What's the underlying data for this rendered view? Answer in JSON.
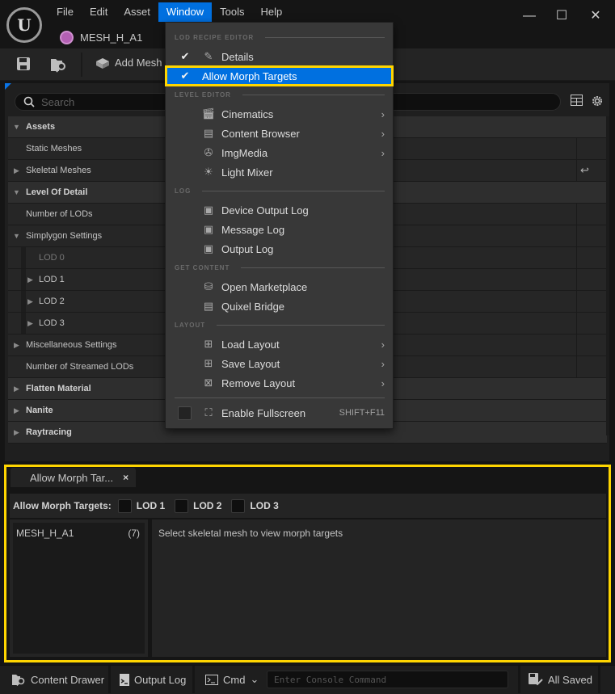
{
  "app": {
    "logo_glyph": "U",
    "menu": [
      "File",
      "Edit",
      "Asset",
      "Window",
      "Tools",
      "Help"
    ],
    "active_menu": "Window",
    "document_tab": "MESH_H_A1",
    "window_controls": {
      "minimize": "—",
      "maximize": "☐",
      "close": "✕"
    }
  },
  "toolbar": {
    "save_icon": "save-icon",
    "browse_icon": "browse-content-icon",
    "add_mesh_label": "Add Mesh"
  },
  "details": {
    "search_placeholder": "Search",
    "rows": [
      {
        "label": "Assets",
        "type": "category",
        "expanded": true
      },
      {
        "label": "Static Meshes",
        "type": "property"
      },
      {
        "label": "Skeletal Meshes",
        "type": "property",
        "collapsed": true,
        "reset": true
      },
      {
        "label": "Level Of Detail",
        "type": "category",
        "expanded": true
      },
      {
        "label": "Number of LODs",
        "type": "property"
      },
      {
        "label": "Simplygon Settings",
        "type": "group",
        "expanded": true
      },
      {
        "label": "LOD 0",
        "type": "sub",
        "disabled": true
      },
      {
        "label": "LOD 1",
        "type": "sub",
        "collapsed": true
      },
      {
        "label": "LOD 2",
        "type": "sub",
        "collapsed": true
      },
      {
        "label": "LOD 3",
        "type": "sub",
        "collapsed": true
      },
      {
        "label": "Miscellaneous  Settings",
        "type": "property",
        "collapsed": true
      },
      {
        "label": "Number of Streamed LODs",
        "type": "property"
      },
      {
        "label": "Flatten Material",
        "type": "category",
        "collapsed": true
      },
      {
        "label": "Nanite",
        "type": "category",
        "collapsed": true
      },
      {
        "label": "Raytracing",
        "type": "category",
        "collapsed": true
      }
    ]
  },
  "window_menu": {
    "sections": {
      "lod_recipe_editor": "LOD RECIPE EDITOR",
      "level_editor": "LEVEL EDITOR",
      "log": "LOG",
      "get_content": "GET CONTENT",
      "layout": "LAYOUT"
    },
    "items": {
      "details": "Details",
      "allow_morph_targets": "Allow Morph Targets",
      "cinematics": "Cinematics",
      "content_browser": "Content Browser",
      "imgmedia": "ImgMedia",
      "light_mixer": "Light Mixer",
      "device_output_log": "Device Output Log",
      "message_log": "Message Log",
      "output_log": "Output Log",
      "open_marketplace": "Open Marketplace",
      "quixel_bridge": "Quixel Bridge",
      "load_layout": "Load Layout",
      "save_layout": "Save Layout",
      "remove_layout": "Remove Layout",
      "enable_fullscreen": "Enable Fullscreen"
    },
    "shortcut_fullscreen": "SHIFT+F11",
    "checked": [
      "Details",
      "Allow Morph Targets"
    ]
  },
  "morph_panel": {
    "tab_label": "Allow Morph Tar...",
    "tab_close": "×",
    "bar_title": "Allow Morph Targets:",
    "lods": [
      "LOD 1",
      "LOD 2",
      "LOD 3"
    ],
    "mesh_name": "MESH_H_A1",
    "mesh_count": "(7)",
    "message": "Select skeletal mesh to view morph targets"
  },
  "statusbar": {
    "content_drawer": "Content Drawer",
    "output_log": "Output Log",
    "cmd": "Cmd",
    "console_placeholder": "Enter Console Command",
    "saved": "All Saved"
  },
  "colors": {
    "accent": "#0070e0",
    "highlight_outline": "#ffd500"
  }
}
